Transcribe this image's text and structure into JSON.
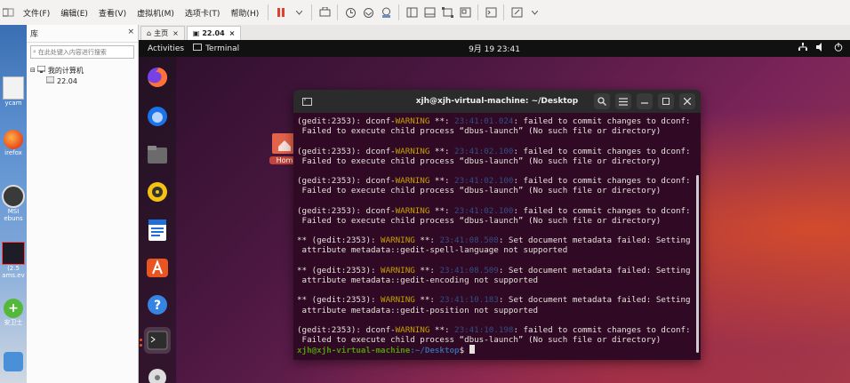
{
  "host": {
    "menu": [
      "文件(F)",
      "编辑(E)",
      "查看(V)",
      "虚拟机(M)",
      "选项卡(T)",
      "帮助(H)"
    ],
    "library": {
      "title": "库",
      "search_placeholder": "在此处键入内容进行搜索",
      "tree": [
        {
          "label": "我的计算机",
          "level": 0
        },
        {
          "label": "22.04",
          "level": 1
        }
      ]
    },
    "tabs": [
      {
        "label": "主页",
        "active": false
      },
      {
        "label": "22.04",
        "active": true
      }
    ],
    "desktop_icons": [
      "ycam",
      "irefox",
      "MSI",
      "ebuns",
      "(2.5",
      "ams.ev",
      "安卫士"
    ]
  },
  "guest": {
    "topbar": {
      "activities": "Activities",
      "app": "Terminal",
      "clock": "9月 19  23:41"
    },
    "desktop_home_label": "Hom",
    "dock_items": [
      "firefox-icon",
      "thunderbird-icon",
      "files-icon",
      "rhythmbox-icon",
      "writer-icon",
      "app-center-icon",
      "help-icon",
      "terminal-icon"
    ],
    "terminal": {
      "title": "xjh@xjh-virtual-machine: ~/Desktop",
      "lines": [
        {
          "type": "dconf",
          "pre": "(gedit:2353): dconf-",
          "level": "WARNING",
          "mid": " **: ",
          "ts": "23:41:01.024",
          "msg": ": failed to commit changes to dconf:"
        },
        {
          "type": "text",
          "text": " Failed to execute child process “dbus-launch” (No such file or directory)"
        },
        {
          "type": "blank"
        },
        {
          "type": "dconf",
          "pre": "(gedit:2353): dconf-",
          "level": "WARNING",
          "mid": " **: ",
          "ts": "23:41:02.100",
          "msg": ": failed to commit changes to dconf:"
        },
        {
          "type": "text",
          "text": " Failed to execute child process “dbus-launch” (No such file or directory)"
        },
        {
          "type": "blank"
        },
        {
          "type": "dconf",
          "pre": "(gedit:2353): dconf-",
          "level": "WARNING",
          "mid": " **: ",
          "ts": "23:41:02.100",
          "msg": ": failed to commit changes to dconf:"
        },
        {
          "type": "text",
          "text": " Failed to execute child process “dbus-launch” (No such file or directory)"
        },
        {
          "type": "blank"
        },
        {
          "type": "dconf",
          "pre": "(gedit:2353): dconf-",
          "level": "WARNING",
          "mid": " **: ",
          "ts": "23:41:02.100",
          "msg": ": failed to commit changes to dconf:"
        },
        {
          "type": "text",
          "text": " Failed to execute child process “dbus-launch” (No such file or directory)"
        },
        {
          "type": "blank"
        },
        {
          "type": "dconf",
          "pre": "** (gedit:2353): ",
          "level": "WARNING",
          "mid": " **: ",
          "ts": "23:41:08.508",
          "msg": ": Set document metadata failed: Setting"
        },
        {
          "type": "text",
          "text": " attribute metadata::gedit-spell-language not supported"
        },
        {
          "type": "blank"
        },
        {
          "type": "dconf",
          "pre": "** (gedit:2353): ",
          "level": "WARNING",
          "mid": " **: ",
          "ts": "23:41:08.509",
          "msg": ": Set document metadata failed: Setting"
        },
        {
          "type": "text",
          "text": " attribute metadata::gedit-encoding not supported"
        },
        {
          "type": "blank"
        },
        {
          "type": "dconf",
          "pre": "** (gedit:2353): ",
          "level": "WARNING",
          "mid": " **: ",
          "ts": "23:41:10.183",
          "msg": ": Set document metadata failed: Setting"
        },
        {
          "type": "text",
          "text": " attribute metadata::gedit-position not supported"
        },
        {
          "type": "blank"
        },
        {
          "type": "dconf",
          "pre": "(gedit:2353): dconf-",
          "level": "WARNING",
          "mid": " **: ",
          "ts": "23:41:10.198",
          "msg": ": failed to commit changes to dconf:"
        },
        {
          "type": "text",
          "text": " Failed to execute child process “dbus-launch” (No such file or directory)"
        }
      ],
      "prompt_user": "xjh@xjh-virtual-machine",
      "prompt_path": ":~/Desktop",
      "prompt_symbol": "$ "
    }
  }
}
